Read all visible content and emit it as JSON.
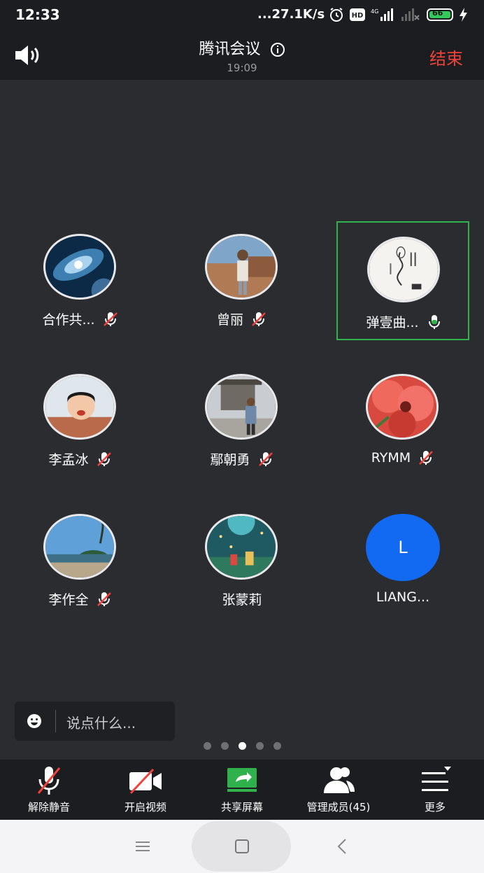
{
  "status_bar": {
    "time": "12:33",
    "net_speed": "...27.1K/s",
    "hd_label": "HD",
    "network_label": "4G",
    "battery_level": "66"
  },
  "header": {
    "title": "腾讯会议",
    "duration": "19:09",
    "end_label": "结束"
  },
  "participants": [
    {
      "name": "合作共...",
      "mic": "muted",
      "avatar": "galaxy-photo"
    },
    {
      "name": "曾丽",
      "mic": "muted",
      "avatar": "person-photo"
    },
    {
      "name": "弹壹曲...",
      "mic": "on",
      "avatar": "ink-painting",
      "active": true
    },
    {
      "name": "李孟冰",
      "mic": "muted",
      "avatar": "child-photo"
    },
    {
      "name": "鄢朝勇",
      "mic": "muted",
      "avatar": "person-tower-photo"
    },
    {
      "name": "RYMM",
      "mic": "muted",
      "avatar": "red-flower-photo"
    },
    {
      "name": "李作全",
      "mic": "muted",
      "avatar": "seaside-photo"
    },
    {
      "name": "张蒙莉",
      "mic": "none",
      "avatar": "little-prince-illustration"
    },
    {
      "name": "LIANG...",
      "mic": "none",
      "avatar_letter": "L"
    }
  ],
  "chat": {
    "placeholder": "说点什么..."
  },
  "pagination": {
    "total": 5,
    "current": 3
  },
  "toolbar": {
    "unmute_label": "解除静音",
    "video_label": "开启视频",
    "share_label": "共享屏幕",
    "members_label": "管理成员(45)",
    "more_label": "更多"
  },
  "colors": {
    "background": "#2b2c30",
    "bar": "#1c1d20",
    "end_red": "#f0413c",
    "speaking_green": "#2fb14b",
    "avatar_blue": "#1269f2"
  }
}
